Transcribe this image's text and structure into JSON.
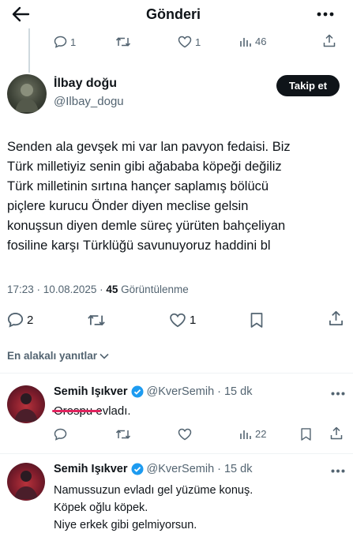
{
  "header": {
    "title": "Gönderi"
  },
  "parent_tweet_stats": {
    "replies": "1",
    "likes": "1",
    "views": "46"
  },
  "main_tweet": {
    "display_name": "İlbay doğu",
    "handle": "@Ilbay_dogu",
    "follow_label": "Takip et",
    "text_lines": [
      "Senden ala gevşek mi var lan pavyon fedaisi. Biz",
      "Türk milletiyiz senin gibi ağababa köpeği değiliz",
      "Türk milletinin sırtına hançer saplamış bölücü",
      "piçlere kurucu Önder diyen meclise gelsin",
      "konuşsun diyen demle süreç yürüten bahçeliyan",
      "fosiline karşı Türklüğü savunuyoruz haddini bl"
    ],
    "time": "17:23",
    "date_sep": " · ",
    "date": "10.08.2025",
    "views_sep": " · ",
    "views_count": "45",
    "views_label": "Görüntülenme",
    "replies": "2",
    "likes": "1"
  },
  "sort": {
    "label": "En alakalı yanıtlar"
  },
  "replies": [
    {
      "display_name": "Semih Işıkver",
      "handle": "@KverSemih",
      "sep": "·",
      "time": "15 dk",
      "struck_word": "Orospu",
      "text_after": " evladı.",
      "views": "22"
    },
    {
      "display_name": "Semih Işıkver",
      "handle": "@KverSemih",
      "sep": "·",
      "time": "15 dk",
      "lines": [
        "Namussuzun evladı gel yüzüme konuş.",
        "Köpek oğlu köpek.",
        "Niye erkek gibi gelmiyorsun."
      ]
    }
  ],
  "colors": {
    "accent": "#1d9bf0",
    "text": "#0f1419",
    "muted": "#536471",
    "strike": "#e0245e"
  }
}
